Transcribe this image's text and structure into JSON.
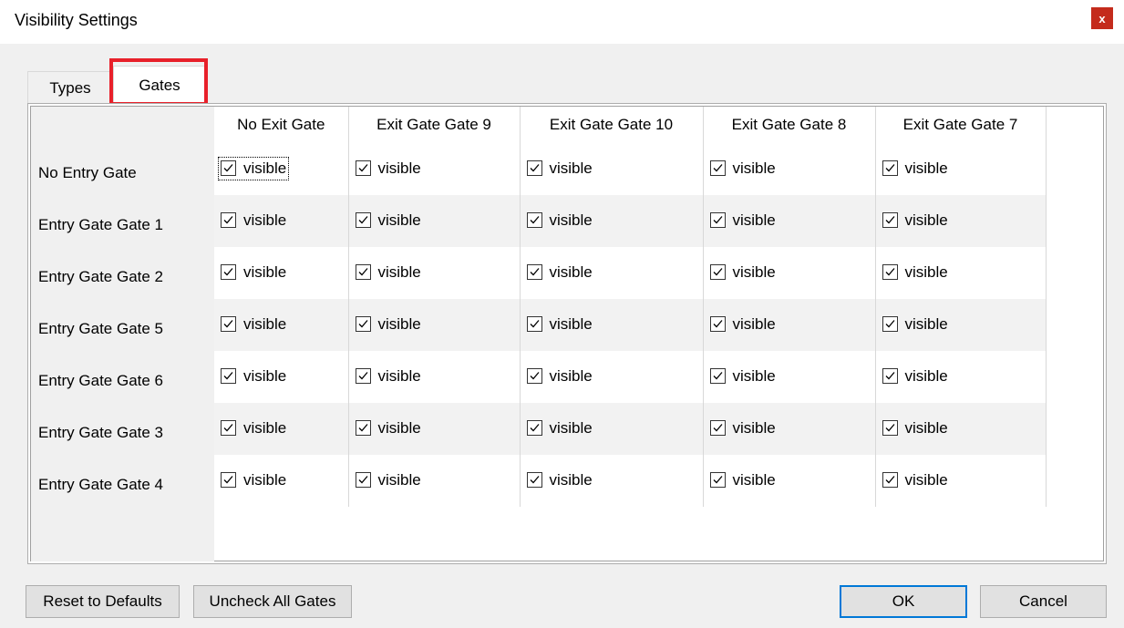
{
  "window": {
    "title": "Visibility Settings",
    "close_label": "x"
  },
  "tabs": [
    {
      "label": "Types",
      "selected": false
    },
    {
      "label": "Gates",
      "selected": true
    }
  ],
  "grid": {
    "columns": [
      "No Exit Gate",
      "Exit Gate Gate 9",
      "Exit Gate Gate 10",
      "Exit Gate Gate 8",
      "Exit Gate Gate 7"
    ],
    "rows": [
      {
        "label": "No Entry Gate",
        "cells": [
          "visible",
          "visible",
          "visible",
          "visible",
          "visible"
        ]
      },
      {
        "label": "Entry Gate Gate 1",
        "cells": [
          "visible",
          "visible",
          "visible",
          "visible",
          "visible"
        ]
      },
      {
        "label": "Entry Gate Gate 2",
        "cells": [
          "visible",
          "visible",
          "visible",
          "visible",
          "visible"
        ]
      },
      {
        "label": "Entry Gate Gate 5",
        "cells": [
          "visible",
          "visible",
          "visible",
          "visible",
          "visible"
        ]
      },
      {
        "label": "Entry Gate Gate 6",
        "cells": [
          "visible",
          "visible",
          "visible",
          "visible",
          "visible"
        ]
      },
      {
        "label": "Entry Gate Gate 3",
        "cells": [
          "visible",
          "visible",
          "visible",
          "visible",
          "visible"
        ]
      },
      {
        "label": "Entry Gate Gate 4",
        "cells": [
          "visible",
          "visible",
          "visible",
          "visible",
          "visible"
        ]
      }
    ],
    "checked": true
  },
  "buttons": {
    "reset": "Reset to Defaults",
    "uncheck": "Uncheck All Gates",
    "ok": "OK",
    "cancel": "Cancel"
  },
  "colors": {
    "highlight": "#e8202a",
    "close_bg": "#c42b1c",
    "ok_border": "#0078d7"
  }
}
